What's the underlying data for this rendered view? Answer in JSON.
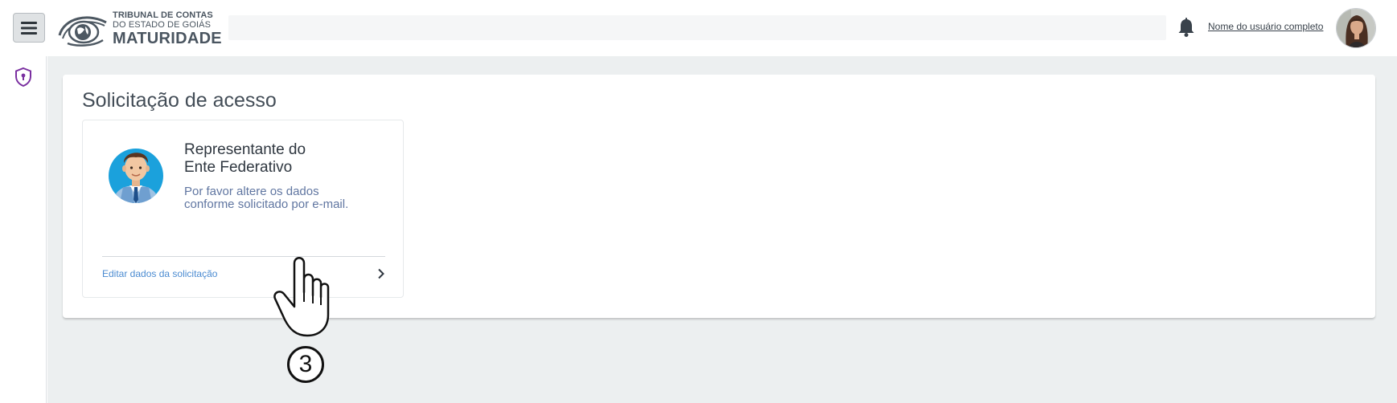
{
  "header": {
    "menu_icon": "hamburger-menu-icon",
    "logo": {
      "line1": "TRIBUNAL DE CONTAS",
      "line2": "DO ESTADO DE GOIÁS",
      "line3": "MATURIDADE"
    },
    "search": {
      "value": "",
      "placeholder": ""
    },
    "notification_icon": "bell-icon",
    "user_name": "Nome do usuário completo",
    "avatar": "user-avatar-photo"
  },
  "sidebar": {
    "items": [
      {
        "icon": "shield-keyhole-icon",
        "color": "#7a2fa0"
      }
    ]
  },
  "main": {
    "title": "Solicitação de acesso",
    "card": {
      "title": "Representante do\nEnte Federativo",
      "description": "Por favor altere os dados\nconforme solicitado por e-mail.",
      "link_label": "Editar dados da solicitação",
      "link_icon": "chevron-right-icon",
      "avatar_icon": "representative-avatar-icon"
    }
  },
  "overlay": {
    "cursor_icon": "pointing-hand-icon",
    "step_number": "3"
  },
  "colors": {
    "content_bg": "#eceff0",
    "link": "#4b8bd1",
    "description": "#6076a1",
    "accent_purple": "#7a2fa0"
  }
}
